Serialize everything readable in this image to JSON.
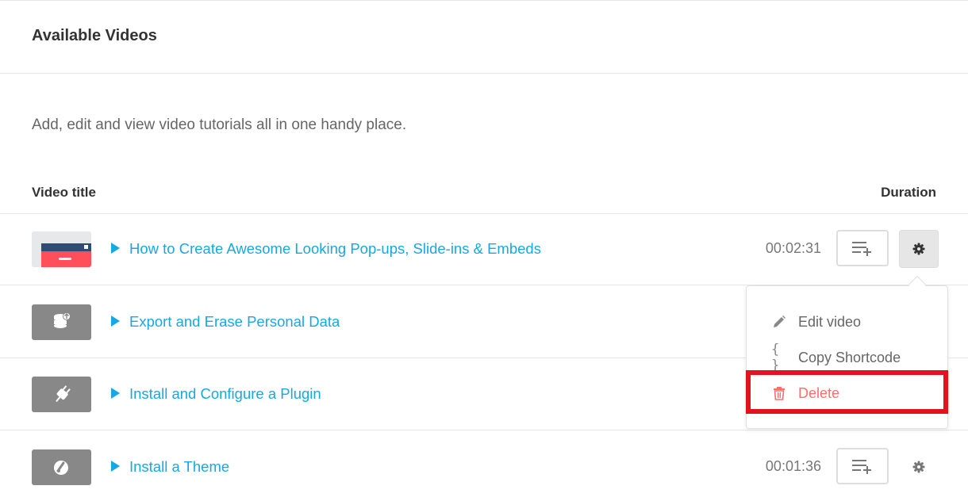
{
  "panel": {
    "title": "Available Videos",
    "description": "Add, edit and view video tutorials all in one handy place."
  },
  "table": {
    "columns": {
      "title": "Video title",
      "duration": "Duration"
    },
    "rows": [
      {
        "title": "How to Create Awesome Looking Pop-ups, Slide-ins & Embeds",
        "duration": "00:02:31",
        "thumb_icon": "popup-thumbnail-icon",
        "show_actions": true,
        "gear_active": true
      },
      {
        "title": "Export and Erase Personal Data",
        "duration": "",
        "thumb_icon": "database-export-icon",
        "show_actions": false,
        "gear_active": false
      },
      {
        "title": "Install and Configure a Plugin",
        "duration": "",
        "thumb_icon": "plug-icon",
        "show_actions": false,
        "gear_active": false
      },
      {
        "title": "Install a Theme",
        "duration": "00:01:36",
        "thumb_icon": "brush-icon",
        "show_actions": true,
        "gear_active": false
      }
    ]
  },
  "dropdown": {
    "items": [
      {
        "label": "Edit video",
        "icon": "pencil-icon"
      },
      {
        "label": "Copy Shortcode",
        "icon": "curly-braces-icon",
        "glyph": "{ }"
      },
      {
        "label": "Delete",
        "icon": "trash-icon"
      }
    ]
  },
  "colors": {
    "link": "#17a8e3",
    "danger": "#ff6d6d",
    "highlight": "#e4121d",
    "thumb": "#888888"
  }
}
